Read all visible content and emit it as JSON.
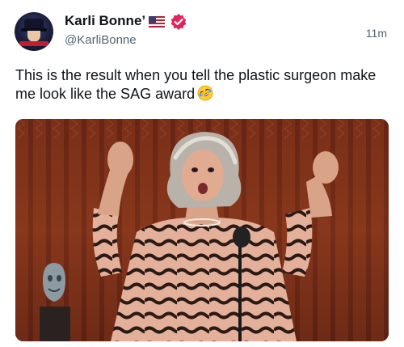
{
  "author": {
    "display_name": "Karli Bonne’",
    "handle": "@KarliBonne",
    "flag_icon": "us-flag-icon",
    "badge_icon": "verified-badge-icon",
    "badge_color": "#e0245e"
  },
  "post": {
    "timestamp": "11m",
    "text": "This is the result when you tell the plastic surgeon make me look like the SAG award",
    "emoji": "rolling-on-floor-laughing-emoji"
  },
  "media": {
    "type": "photo"
  }
}
